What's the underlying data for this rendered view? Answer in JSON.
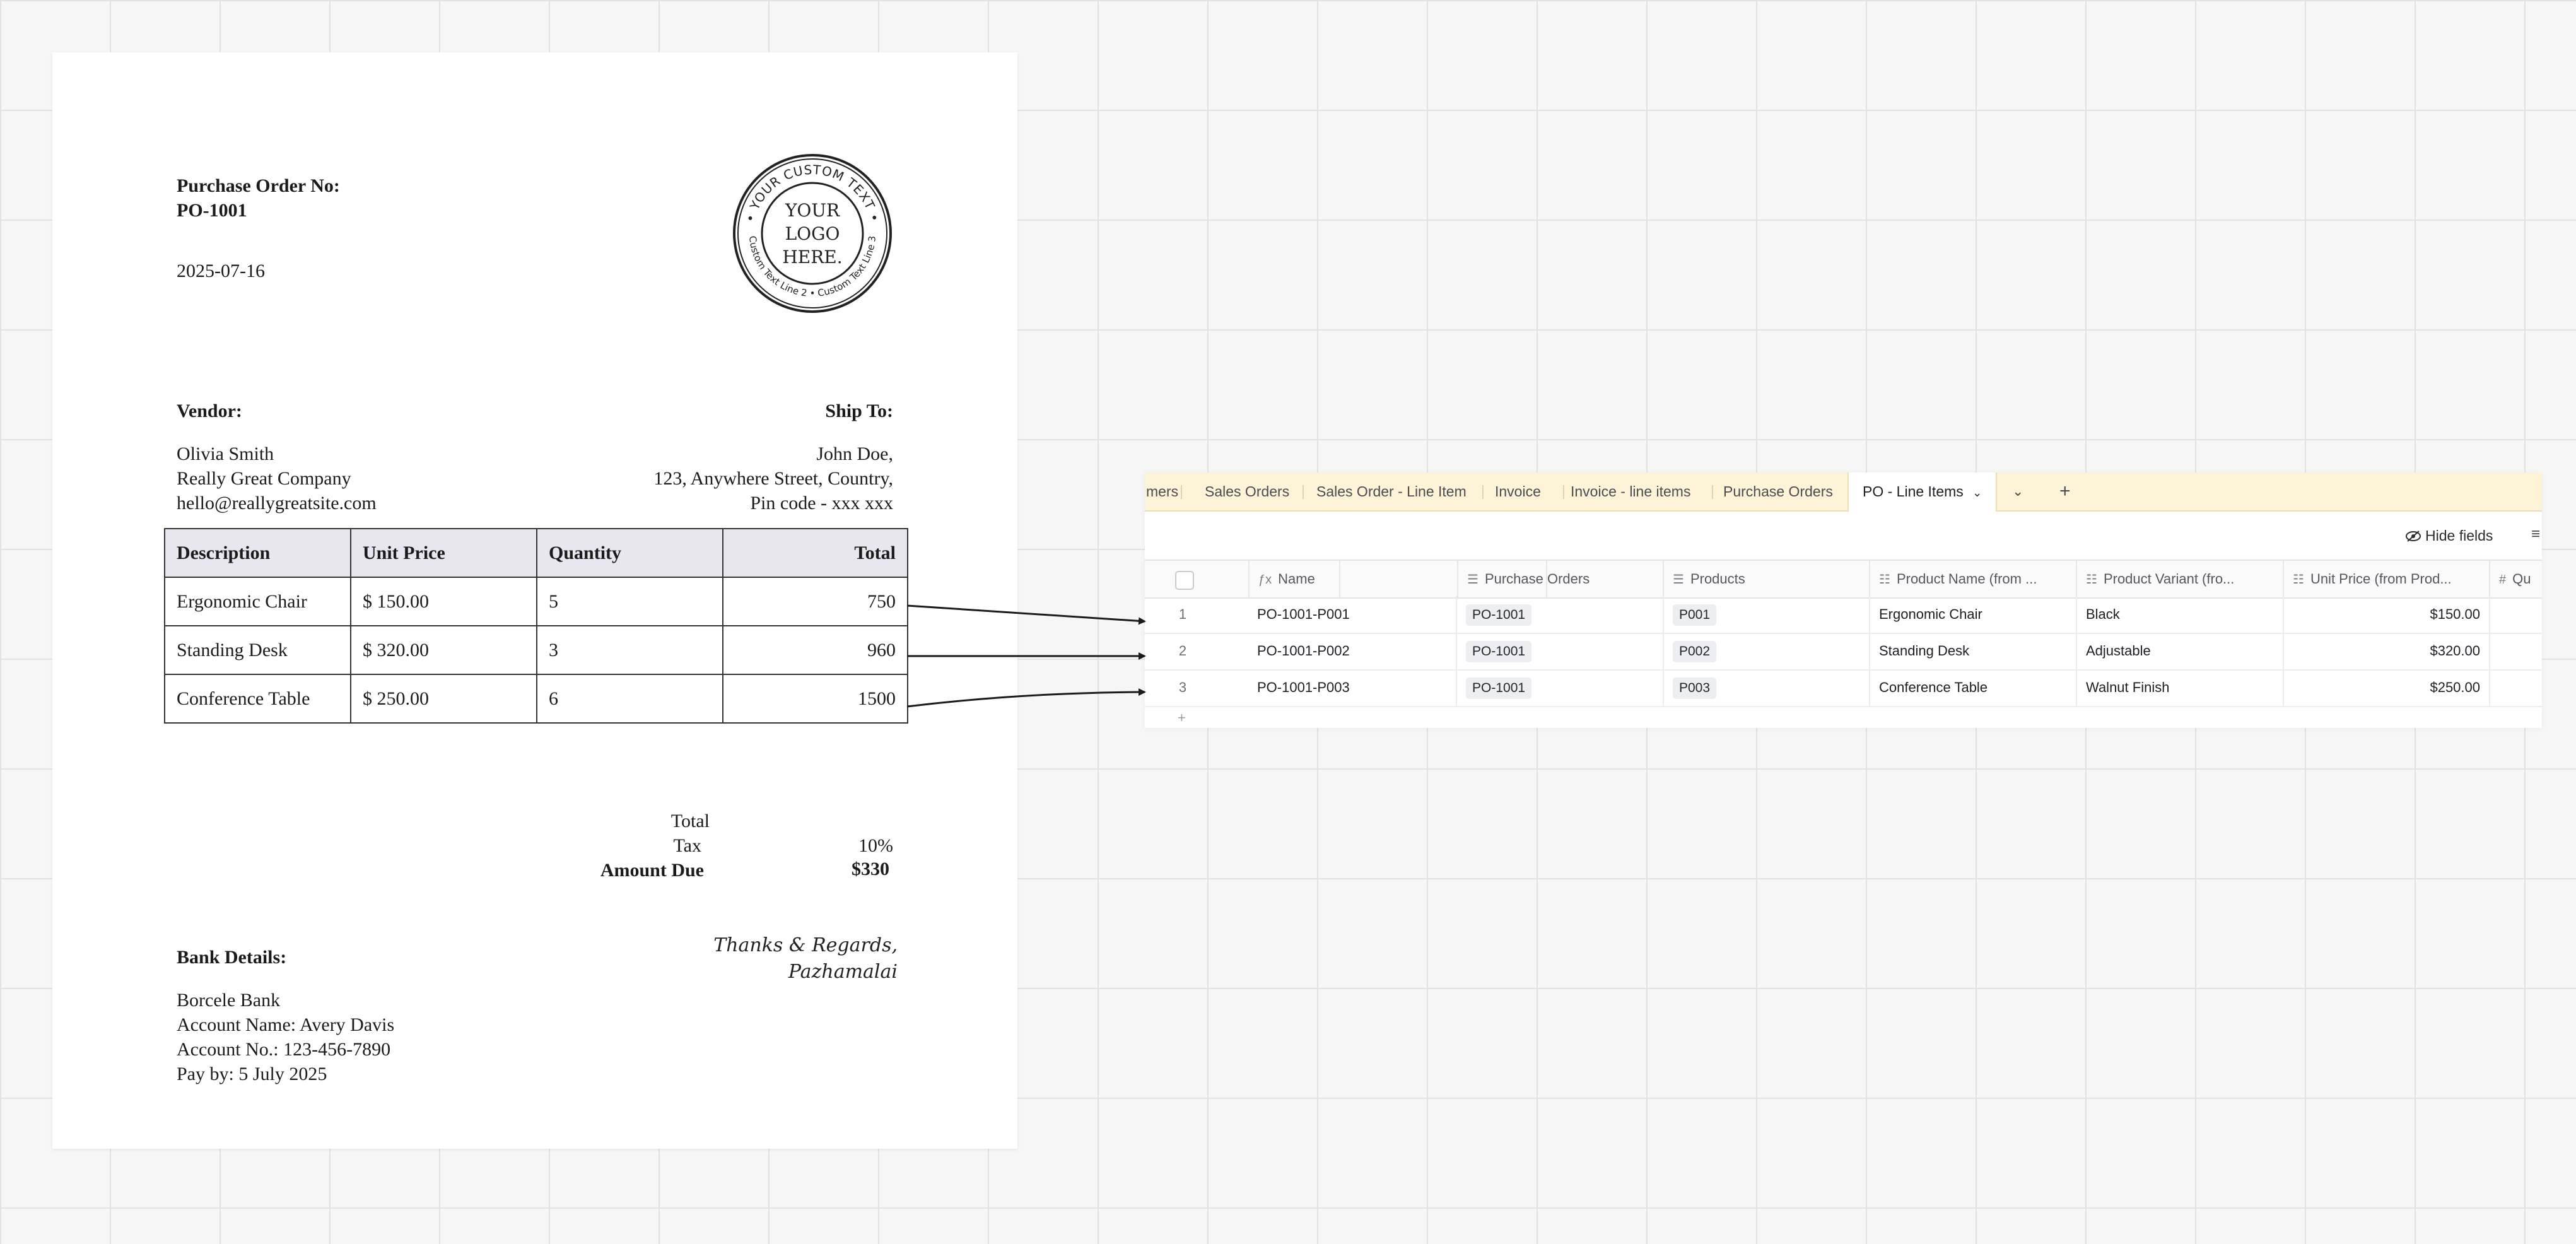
{
  "po_document": {
    "po_label": "Purchase Order No:",
    "po_number": "PO-1001",
    "date": "2025-07-16",
    "stamp": {
      "top_text": "• YOUR CUSTOM TEXT •",
      "bottom_text": "Custom Text Line 2 • Custom Text Line 3",
      "center_lines": [
        "YOUR",
        "LOGO",
        "HERE."
      ]
    },
    "vendor": {
      "heading": "Vendor:",
      "lines": [
        "Olivia Smith",
        "Really Great Company",
        "hello@reallygreatsite.com"
      ]
    },
    "ship_to": {
      "heading": "Ship To:",
      "lines": [
        "John Doe,",
        "123, Anywhere Street, Country,",
        "Pin code - xxx xxx"
      ]
    },
    "table": {
      "headers": [
        "Description",
        "Unit Price",
        "Quantity",
        "Total"
      ],
      "rows": [
        [
          "Ergonomic Chair",
          "$ 150.00",
          "5",
          "750"
        ],
        [
          "Standing Desk",
          "$ 320.00",
          "3",
          "960"
        ],
        [
          "Conference Table",
          "$ 250.00",
          "6",
          "1500"
        ]
      ]
    },
    "summary": {
      "total_label": "Total",
      "total_value": "",
      "tax_label": "Tax",
      "tax_value": "10%",
      "amount_due_label": "Amount Due",
      "amount_due_value": "$330"
    },
    "bank": {
      "heading": "Bank Details:",
      "lines": [
        "Borcele Bank",
        "Account Name: Avery Davis",
        "Account No.: 123-456-7890",
        "Pay by: 5 July 2025"
      ]
    },
    "signature": [
      "Thanks & Regards,",
      "Pazhamalai"
    ]
  },
  "grid": {
    "tabs": [
      "mers",
      "Sales Orders",
      "Sales Order - Line Item",
      "Invoice",
      "Invoice - line items",
      "Purchase Orders"
    ],
    "active_tab": "PO - Line Items",
    "more_tabs_icon": "chevron-down-icon",
    "add_tab_icon": "plus-icon",
    "hide_fields_label": "Hide fields",
    "columns": [
      {
        "label": "Name",
        "icon": "formula-icon"
      },
      {
        "label": "Purchase Orders",
        "icon": "link-icon"
      },
      {
        "label": "Products",
        "icon": "link-icon"
      },
      {
        "label": "Product Name (from ...",
        "icon": "lookup-icon"
      },
      {
        "label": "Product Variant (fro...",
        "icon": "lookup-icon"
      },
      {
        "label": "Unit Price (from Prod...",
        "icon": "lookup-icon"
      },
      {
        "label": "Qu",
        "icon": "number-icon"
      }
    ],
    "rows": [
      {
        "n": "1",
        "name": "PO-1001-P001",
        "po": "PO-1001",
        "product": "P001",
        "product_name": "Ergonomic Chair",
        "variant": "Black",
        "unit_price": "$150.00"
      },
      {
        "n": "2",
        "name": "PO-1001-P002",
        "po": "PO-1001",
        "product": "P002",
        "product_name": "Standing Desk",
        "variant": "Adjustable",
        "unit_price": "$320.00"
      },
      {
        "n": "3",
        "name": "PO-1001-P003",
        "po": "PO-1001",
        "product": "P003",
        "product_name": "Conference Table",
        "variant": "Walnut Finish",
        "unit_price": "$250.00"
      }
    ],
    "add_row_symbol": "+"
  }
}
